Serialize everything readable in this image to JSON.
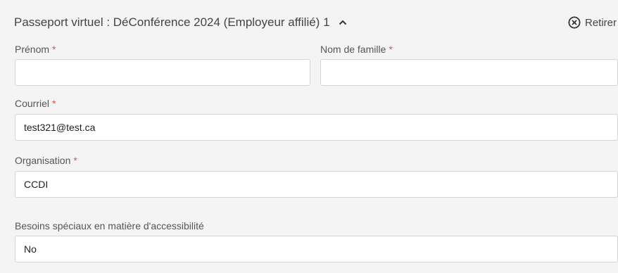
{
  "section": {
    "title": "Passeport virtuel : DéConférence 2024 (Employeur affilié) 1",
    "remove_label": "Retirer"
  },
  "required_marker": "*",
  "fields": {
    "first_name": {
      "label": "Prénom",
      "value": ""
    },
    "last_name": {
      "label": "Nom de famille",
      "value": ""
    },
    "email": {
      "label": "Courriel",
      "value": "test321@test.ca"
    },
    "organization": {
      "label": "Organisation",
      "value": "CCDI"
    },
    "accessibility": {
      "label": "Besoins spéciaux en matière d'accessibilité",
      "value": "No"
    }
  }
}
